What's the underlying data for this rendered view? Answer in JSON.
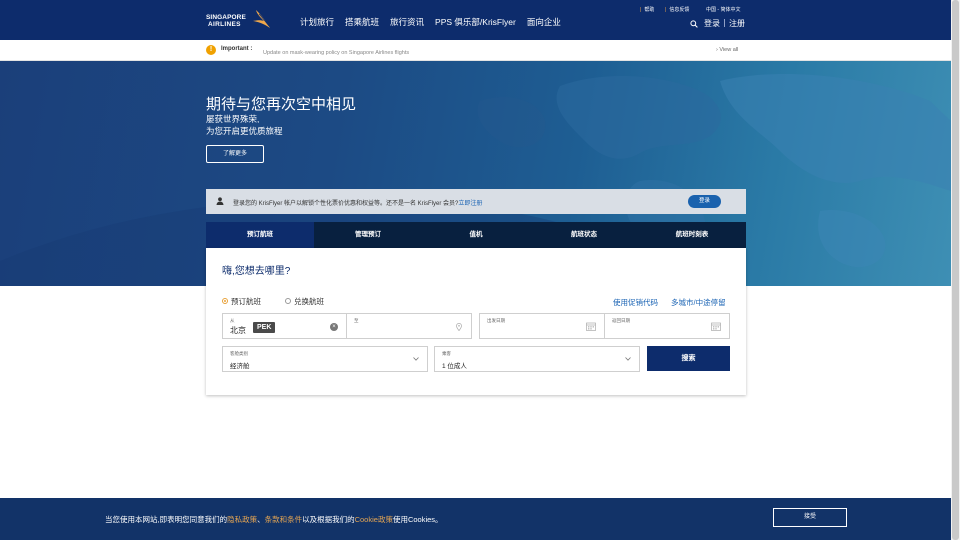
{
  "header": {
    "logo_line1": "SINGAPORE",
    "logo_line2": "AIRLINES",
    "nav": [
      "计划旅行",
      "搭乘航班",
      "旅行资讯",
      "PPS 俱乐部/KrisFlyer",
      "面向企业"
    ],
    "util_help": "帮助",
    "util_feedback": "信息反馈",
    "util_region": "中国 - 简体中文",
    "login": "登录",
    "register": "注册"
  },
  "notice": {
    "label": "Important :",
    "message": "Update on mask-wearing policy on Singapore Airlines flights",
    "view_all": "View all"
  },
  "hero": {
    "title": "期待与您再次空中相见",
    "subtitle1": "屡获世界殊荣,",
    "subtitle2": "为您开启更优质旅程",
    "learn_more": "了解更多"
  },
  "krisflyer": {
    "text": "登录您的 KrisFlyer 帐户以解锁个性化票价优惠和权益等。还不是一名 KrisFlyer 会员?",
    "link": "立即注册",
    "login": "登录"
  },
  "tabs": [
    "预订航班",
    "管理预订",
    "值机",
    "航班状态",
    "航班时刻表"
  ],
  "booking": {
    "question": "嗨,您想去哪里?",
    "radio_book": "预订航班",
    "radio_redeem": "兑换航班",
    "promo_link": "使用促销代码",
    "multicity_link": "多城市/中途停留",
    "from_label": "从",
    "from_city": "北京",
    "from_code": "PEK",
    "to_label": "至",
    "depart_label": "出发日期",
    "return_label": "返回日期",
    "cabin_label": "客舱类别",
    "cabin_value": "经济舱",
    "pax_label": "乘客",
    "pax_value": "1 位成人",
    "search": "搜索"
  },
  "cookie": {
    "t1": "当您使用本网站,即表明您同意我们的",
    "l1": "隐私政策",
    "t2": "、",
    "l2": "条款和条件",
    "t3": "以及根据我们的",
    "l3": "Cookie政策",
    "t4": "使用Cookies。",
    "accept": "接受"
  },
  "colors": {
    "brand_navy": "#0d2c6c",
    "accent_gold": "#f0a84a",
    "link_blue": "#1b64b4"
  }
}
